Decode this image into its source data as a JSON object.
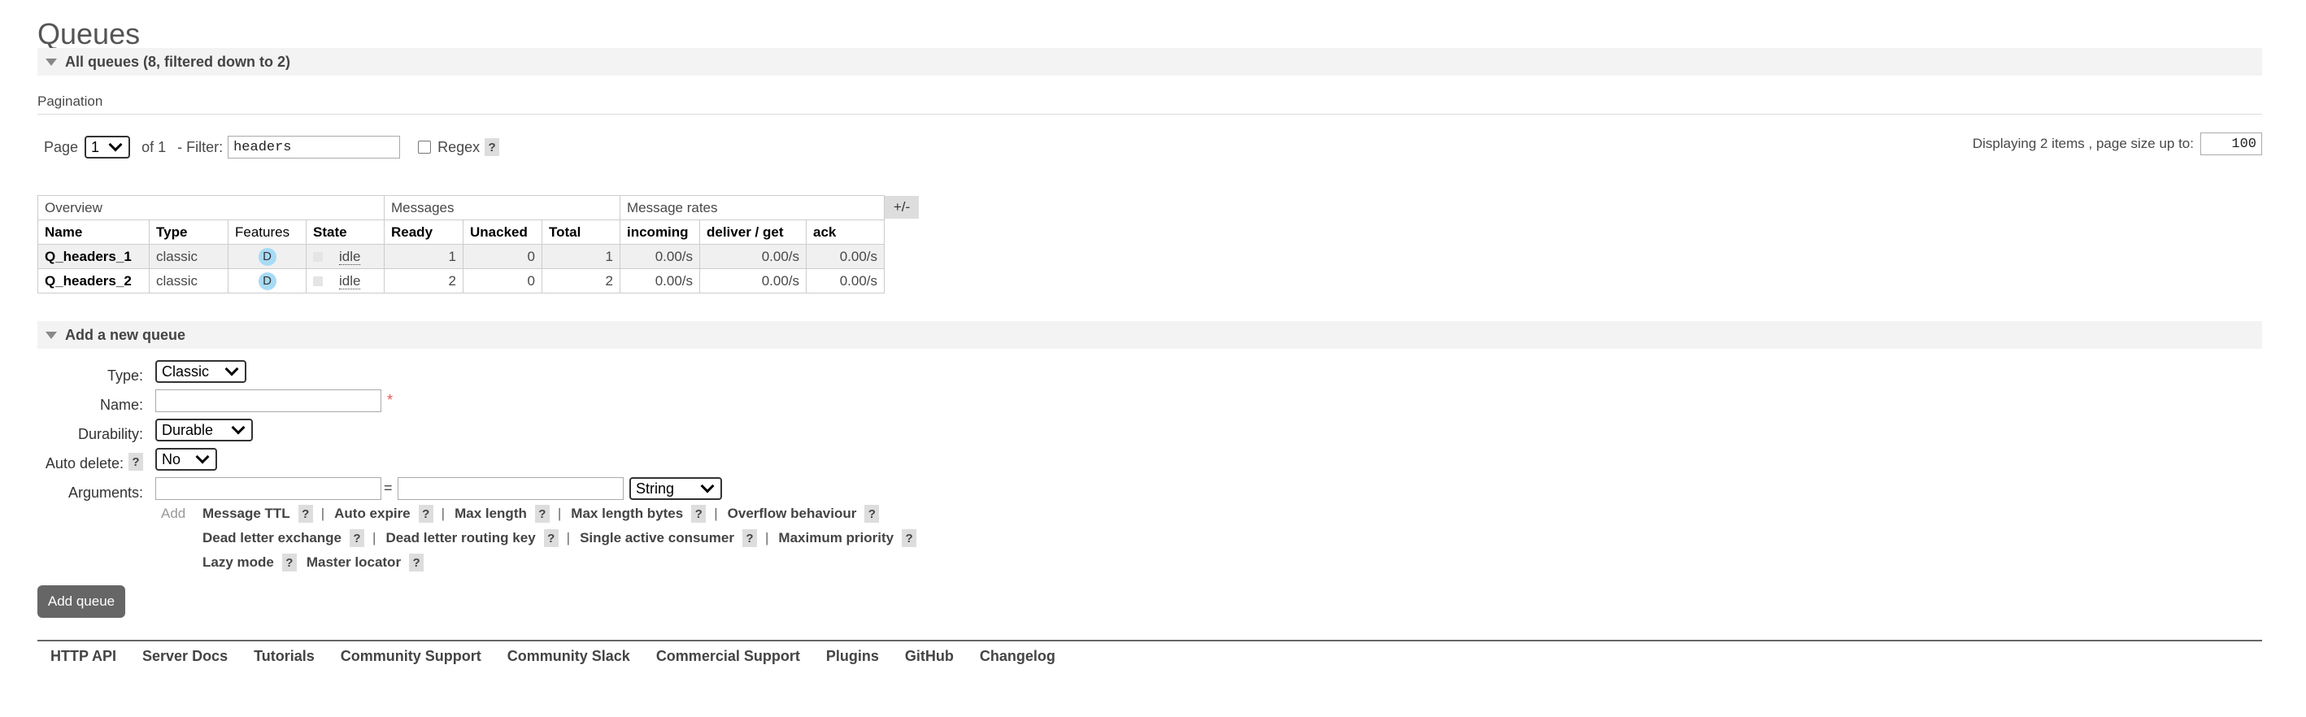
{
  "page": {
    "title": "Queues"
  },
  "all_queues": {
    "header": "All queues (8, filtered down to 2)"
  },
  "pagination": {
    "section_label": "Pagination",
    "page_label": "Page",
    "page_value": "1",
    "of_label": "of 1",
    "filter_label": "- Filter:",
    "filter_value": "headers",
    "regex_label": "Regex",
    "help": "?",
    "displaying": "Displaying 2 items , page size up to:",
    "page_size": "100"
  },
  "table": {
    "groups": [
      "Overview",
      "Messages",
      "Message rates"
    ],
    "columns": [
      "Name",
      "Type",
      "Features",
      "State",
      "Ready",
      "Unacked",
      "Total",
      "incoming",
      "deliver / get",
      "ack"
    ],
    "toggle": "+/-",
    "rows": [
      {
        "name": "Q_headers_1",
        "type": "classic",
        "feature": "D",
        "state": "idle",
        "ready": "1",
        "unacked": "0",
        "total": "1",
        "incoming": "0.00/s",
        "deliver": "0.00/s",
        "ack": "0.00/s"
      },
      {
        "name": "Q_headers_2",
        "type": "classic",
        "feature": "D",
        "state": "idle",
        "ready": "2",
        "unacked": "0",
        "total": "2",
        "incoming": "0.00/s",
        "deliver": "0.00/s",
        "ack": "0.00/s"
      }
    ]
  },
  "add_queue": {
    "header": "Add a new queue",
    "type_label": "Type:",
    "type_value": "Classic",
    "name_label": "Name:",
    "required": "*",
    "durability_label": "Durability:",
    "durability_value": "Durable",
    "autodelete_label": "Auto delete:",
    "autodelete_value": "No",
    "arguments_label": "Arguments:",
    "equals": "=",
    "arg_type_value": "String",
    "add_link": "Add",
    "args_line1": [
      "Message TTL",
      "Auto expire",
      "Max length",
      "Max length bytes",
      "Overflow behaviour"
    ],
    "args_line2": [
      "Dead letter exchange",
      "Dead letter routing key",
      "Single active consumer",
      "Maximum priority"
    ],
    "args_line3": [
      "Lazy mode",
      "Master locator"
    ],
    "submit": "Add queue"
  },
  "footer": {
    "links": [
      "HTTP API",
      "Server Docs",
      "Tutorials",
      "Community Support",
      "Community Slack",
      "Commercial Support",
      "Plugins",
      "GitHub",
      "Changelog"
    ]
  }
}
